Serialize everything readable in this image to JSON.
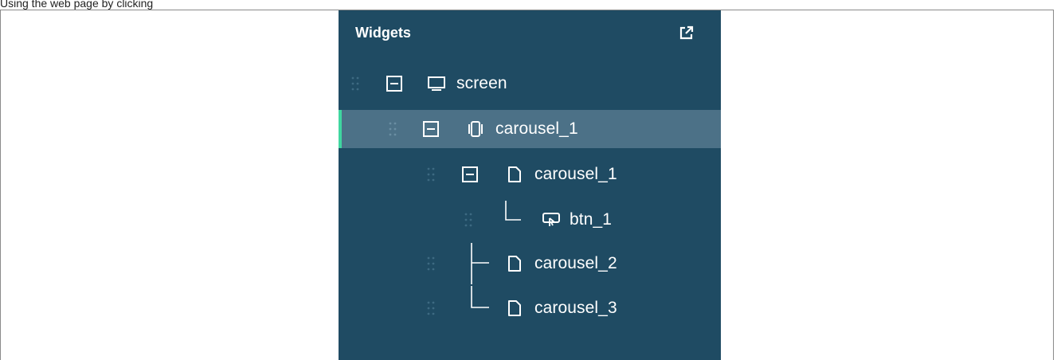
{
  "window": {
    "caption_fragment": "Using the web page by clicking"
  },
  "panel": {
    "title": "Widgets",
    "popout_icon": "external-link-icon"
  },
  "tree": {
    "nodes": [
      {
        "label": "screen",
        "icon": "monitor-icon",
        "expanded": true,
        "selected": false
      },
      {
        "label": "carousel_1",
        "icon": "carousel-icon",
        "expanded": true,
        "selected": true
      },
      {
        "label": "carousel_1",
        "icon": "page-icon",
        "expanded": true,
        "selected": false
      },
      {
        "label": "btn_1",
        "icon": "button-icon",
        "expanded": false,
        "selected": false
      },
      {
        "label": "carousel_2",
        "icon": "page-icon",
        "expanded": false,
        "selected": false
      },
      {
        "label": "carousel_3",
        "icon": "page-icon",
        "expanded": false,
        "selected": false
      }
    ]
  },
  "colors": {
    "panel_bg": "#1f4b63",
    "selected_row_bg": "#4c7187",
    "selection_accent": "#3fd6a0",
    "text": "#ffffff"
  }
}
